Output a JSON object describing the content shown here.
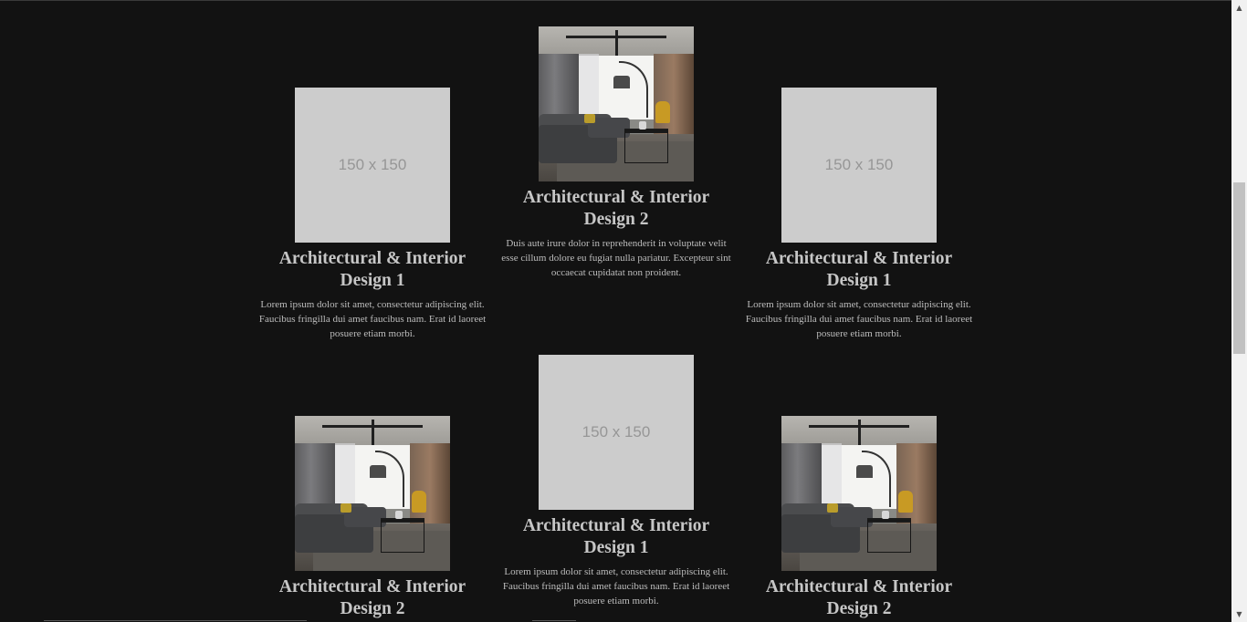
{
  "placeholder_label": "150 x 150",
  "cards": [
    {
      "title": "Architectural & Interior Design 1",
      "text": "Lorem ipsum dolor sit amet, consectetur adipiscing elit. Faucibus fringilla dui amet faucibus nam. Erat id laoreet posuere etiam morbi.",
      "image": "placeholder"
    },
    {
      "title": "Architectural & Interior Design 2",
      "text": "Duis aute irure dolor in reprehenderit in voluptate velit esse cillum dolore eu fugiat nulla pariatur. Excepteur sint occaecat cupidatat non proident.",
      "image": "interior-photo"
    },
    {
      "title": "Architectural & Interior Design 1",
      "text": "Lorem ipsum dolor sit amet, consectetur adipiscing elit. Faucibus fringilla dui amet faucibus nam. Erat id laoreet posuere etiam morbi.",
      "image": "placeholder"
    },
    {
      "title": "Architectural & Interior Design 2",
      "text": "",
      "image": "interior-photo"
    },
    {
      "title": "Architectural & Interior Design 1",
      "text": "Lorem ipsum dolor sit amet, consectetur adipiscing elit. Faucibus fringilla dui amet faucibus nam. Erat id laoreet posuere etiam morbi.",
      "image": "placeholder"
    },
    {
      "title": "Architectural & Interior Design 2",
      "text": "",
      "image": "interior-photo"
    }
  ],
  "scrollbar": {
    "up_icon": "arrow-up-icon",
    "down_icon": "arrow-down-icon"
  },
  "colors": {
    "background": "#121212",
    "placeholder_bg": "#cccccc",
    "placeholder_text": "#969696",
    "title": "#c6c6c6",
    "body_text": "#bdbdbd"
  }
}
